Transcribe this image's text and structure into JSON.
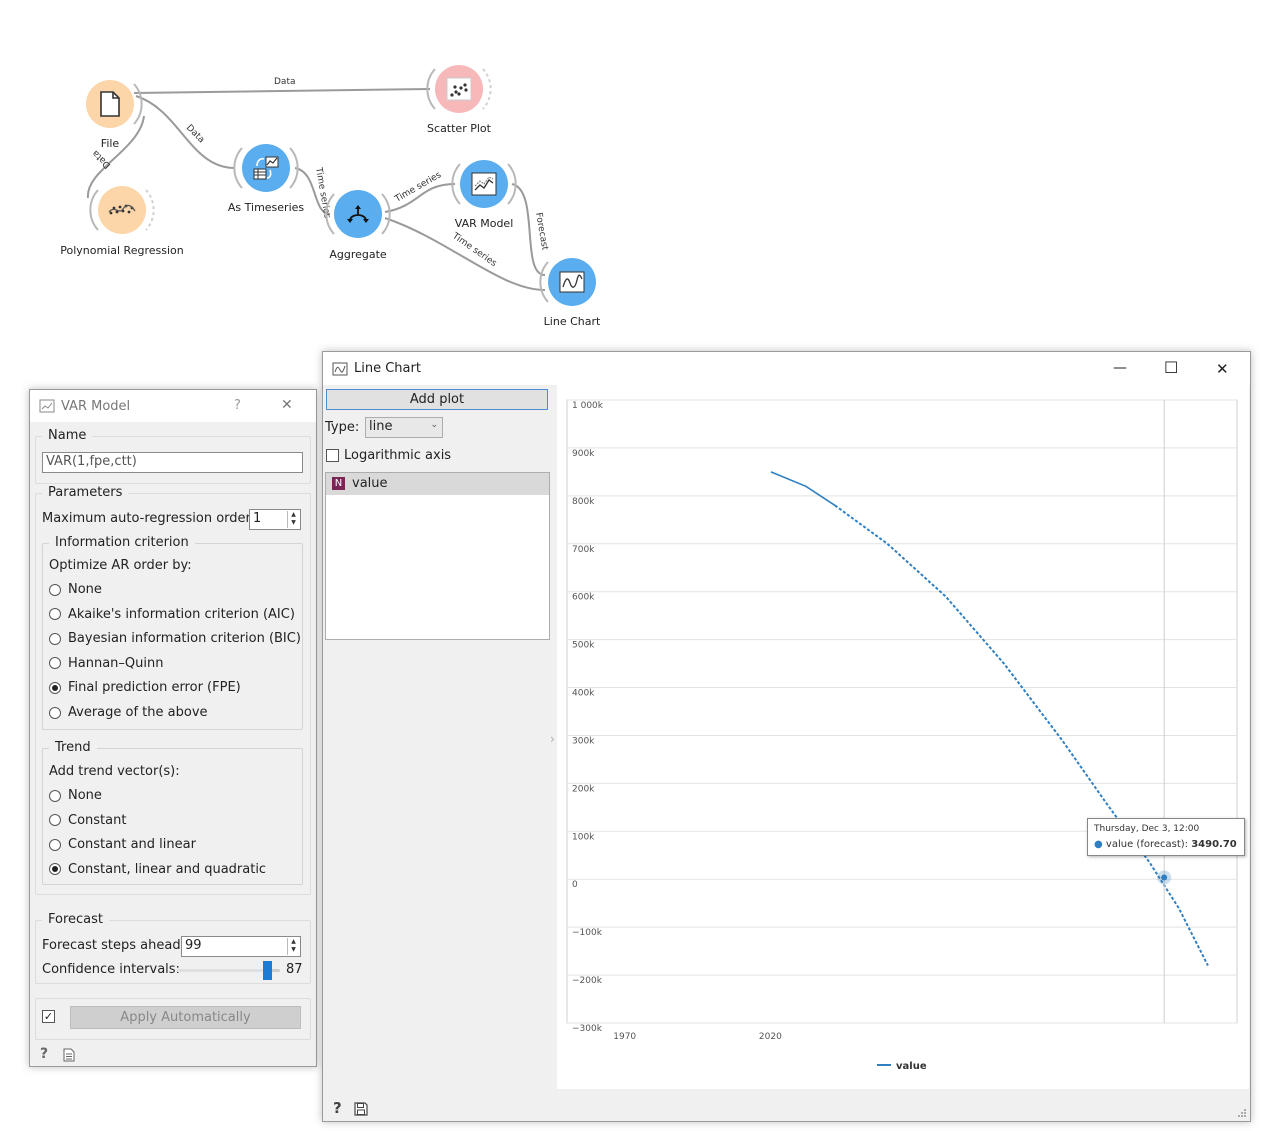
{
  "workflow": {
    "nodes": [
      {
        "id": "file",
        "label": "File",
        "icon": "file-icon"
      },
      {
        "id": "scatter",
        "label": "Scatter Plot",
        "icon": "scatter-plot-icon"
      },
      {
        "id": "timeseries",
        "label": "As Timeseries",
        "icon": "as-timeseries-icon"
      },
      {
        "id": "poly",
        "label": "Polynomial Regression",
        "icon": "polynomial-regression-icon"
      },
      {
        "id": "aggregate",
        "label": "Aggregate",
        "icon": "aggregate-icon"
      },
      {
        "id": "var",
        "label": "VAR Model",
        "icon": "var-model-icon"
      },
      {
        "id": "linechart",
        "label": "Line Chart",
        "icon": "line-chart-icon"
      }
    ],
    "links": {
      "file_scatter": "Data",
      "file_timeseries": "Data",
      "file_poly": "Data",
      "timeseries_aggregate": "Time series",
      "aggregate_var": "Time series",
      "aggregate_linechart": "Time series",
      "var_linechart": "Forecast"
    },
    "colors": {
      "orange": "#fcd5a8",
      "pink": "#f6b8b8",
      "blue": "#5aaef0",
      "blue_dark": "#2e86d6"
    }
  },
  "var_window": {
    "title": "VAR Model",
    "help_glyph": "?",
    "close_glyph": "✕",
    "name_section": "Name",
    "name_value": "VAR(1,fpe,ctt)",
    "parameters_section": "Parameters",
    "max_order_label": "Maximum auto-regression order:",
    "max_order_value": "1",
    "ic_section": "Information criterion",
    "optimize_label": "Optimize AR order by:",
    "ic_options": [
      {
        "label": "None",
        "selected": false
      },
      {
        "label": "Akaike's information criterion (AIC)",
        "selected": false
      },
      {
        "label": "Bayesian information criterion (BIC)",
        "selected": false
      },
      {
        "label": "Hannan–Quinn",
        "selected": false
      },
      {
        "label": "Final prediction error (FPE)",
        "selected": true
      },
      {
        "label": "Average of the above",
        "selected": false
      }
    ],
    "trend_section": "Trend",
    "trend_label": "Add trend vector(s):",
    "trend_options": [
      {
        "label": "None",
        "selected": false
      },
      {
        "label": "Constant",
        "selected": false
      },
      {
        "label": "Constant and linear",
        "selected": false
      },
      {
        "label": "Constant, linear and quadratic",
        "selected": true
      }
    ],
    "forecast_section": "Forecast",
    "steps_label": "Forecast steps ahead:",
    "steps_value": "99",
    "ci_label": "Confidence intervals:",
    "ci_value": "87",
    "ci_fraction": 0.87,
    "apply_label": "Apply Automatically",
    "apply_checked": true
  },
  "chart_window": {
    "title": "Line Chart",
    "minimize_glyph": "—",
    "maximize_glyph": "☐",
    "close_glyph": "✕",
    "add_plot_label": "Add plot",
    "type_label": "Type:",
    "type_value": "line",
    "log_label": "Logarithmic axis",
    "log_checked": false,
    "variables": [
      {
        "badge": "N",
        "name": "value"
      }
    ],
    "collapse_glyph": "›",
    "tooltip": {
      "date": "Thursday, Dec 3, 12:00",
      "series": "value (forecast):",
      "value": "3490.70"
    }
  },
  "chart_data": {
    "type": "line",
    "title": "",
    "xlabel": "",
    "ylabel": "",
    "x_ticks": [
      "1970",
      "2020"
    ],
    "y_ticks": [
      "1 000k",
      "900k",
      "800k",
      "700k",
      "600k",
      "500k",
      "400k",
      "300k",
      "200k",
      "100k",
      "0",
      "−100k",
      "−200k",
      "−300k"
    ],
    "ylim": [
      -300000,
      1000000
    ],
    "grid": true,
    "legend": "bottom",
    "series": [
      {
        "name": "value",
        "color": "#2f7fc1",
        "observed": [
          [
            2020,
            850000
          ],
          [
            2032,
            820000
          ],
          [
            2042,
            780000
          ]
        ],
        "forecast": [
          [
            2042,
            780000
          ],
          [
            2060,
            700000
          ],
          [
            2080,
            590000
          ],
          [
            2100,
            450000
          ],
          [
            2120,
            290000
          ],
          [
            2135,
            160000
          ],
          [
            2150,
            35000
          ],
          [
            2160,
            -60000
          ],
          [
            2170,
            -180000
          ]
        ]
      }
    ],
    "highlight": {
      "x": 2155,
      "y": 3490.7
    }
  }
}
